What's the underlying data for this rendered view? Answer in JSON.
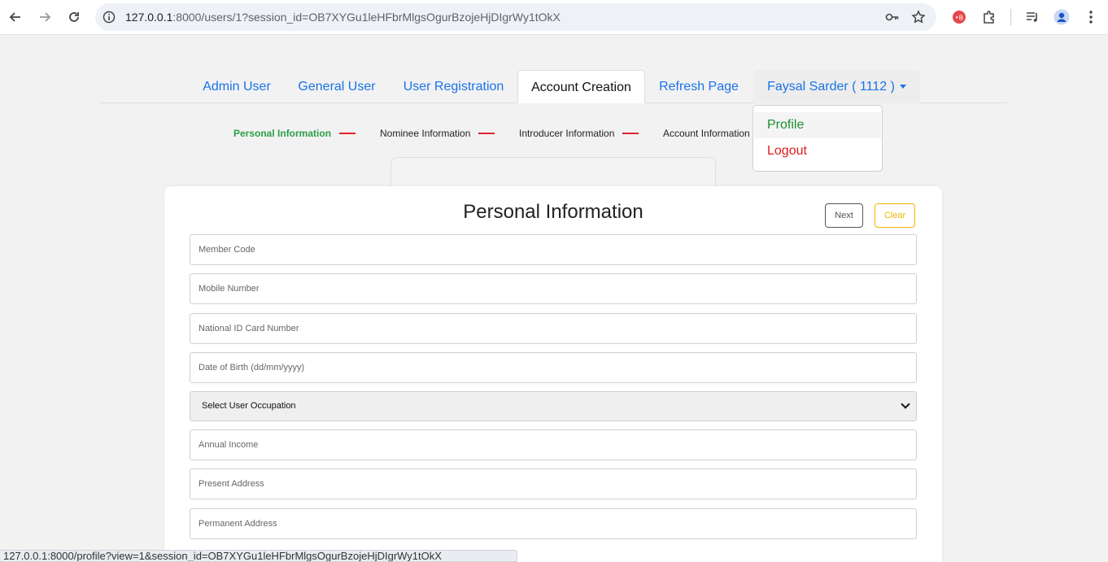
{
  "browser": {
    "url_host": "127.0.0.1",
    "url_rest": ":8000/users/1?session_id=OB7XYGu1leHFbrMlgsOgurBzojeHjDIgrWy1tOkX",
    "status_url": "127.0.0.1:8000/profile?view=1&session_id=OB7XYGu1leHFbrMlgsOgurBzojeHjDIgrWy1tOkX"
  },
  "nav": {
    "tabs": [
      {
        "label": "Admin User"
      },
      {
        "label": "General User"
      },
      {
        "label": "User Registration"
      },
      {
        "label": "Account Creation",
        "active": true
      },
      {
        "label": "Refresh Page"
      }
    ],
    "user_menu": {
      "label": "Faysal Sarder ( 1112 )",
      "items": [
        {
          "label": "Profile"
        },
        {
          "label": "Logout"
        }
      ]
    }
  },
  "steps": [
    {
      "label": "Personal Information",
      "active": true
    },
    {
      "label": "Nominee Information"
    },
    {
      "label": "Introducer Information"
    },
    {
      "label": "Account Information"
    }
  ],
  "form": {
    "title": "Personal Information",
    "next_label": "Next",
    "clear_label": "Clear",
    "fields": [
      {
        "placeholder": "Member Code"
      },
      {
        "placeholder": "Mobile Number"
      },
      {
        "placeholder": "National ID Card Number"
      },
      {
        "placeholder": "Date of Birth (dd/mm/yyyy)"
      },
      {
        "select": "Select User Occupation"
      },
      {
        "placeholder": "Annual Income"
      },
      {
        "placeholder": "Present Address"
      },
      {
        "placeholder": "Permanent Address"
      }
    ]
  },
  "colors": {
    "link": "#1a73e8",
    "active_step": "#2aa047",
    "step_line": "#e02424",
    "profile": "#1f8f2f",
    "logout": "#e01b1b",
    "clear": "#f0b400"
  }
}
